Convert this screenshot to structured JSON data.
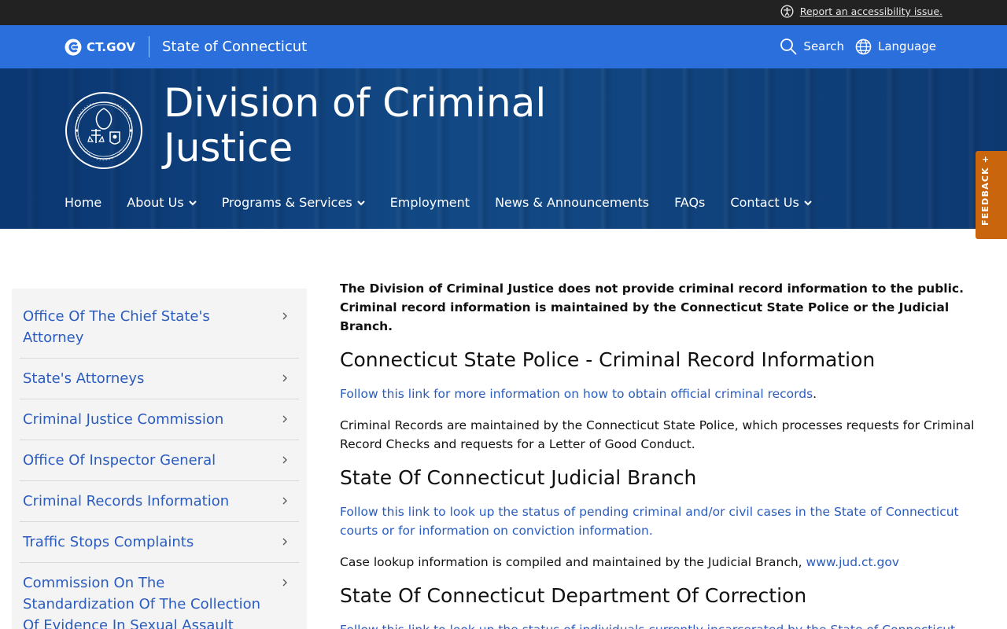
{
  "accessibility_bar": {
    "report_link": "Report an accessibility issue.",
    "icon": "accessibility-icon"
  },
  "ct_bar": {
    "logo_text": "CT.GOV",
    "state_name": "State of Connecticut",
    "search_label": "Search",
    "language_label": "Language",
    "background_color": "#2a6fdb"
  },
  "hero": {
    "title": "Division of Criminal Justice",
    "seal_icon": "division-seal-icon"
  },
  "main_nav": {
    "items": [
      {
        "label": "Home",
        "has_dropdown": false
      },
      {
        "label": "About Us",
        "has_dropdown": true
      },
      {
        "label": "Programs & Services",
        "has_dropdown": true
      },
      {
        "label": "Employment",
        "has_dropdown": false
      },
      {
        "label": "News & Announcements",
        "has_dropdown": false
      },
      {
        "label": "FAQs",
        "has_dropdown": false
      },
      {
        "label": "Contact Us",
        "has_dropdown": true
      }
    ]
  },
  "feedback": {
    "label": "FEEDBACK +",
    "color": "#c9650d"
  },
  "sidebar": {
    "items": [
      {
        "label": "Office Of The Chief State's Attorney"
      },
      {
        "label": "State's Attorneys"
      },
      {
        "label": "Criminal Justice Commission"
      },
      {
        "label": "Office Of Inspector General"
      },
      {
        "label": "Criminal Records Information"
      },
      {
        "label": "Traffic Stops Complaints"
      },
      {
        "label": "Commission On The Standardization Of The Collection Of Evidence In Sexual Assault"
      }
    ],
    "link_color": "#2a5cbf"
  },
  "content": {
    "notice": "The Division of Criminal Justice does not provide criminal record information to the public. Criminal record information is maintained by the Connecticut State Police or the Judicial Branch.",
    "sections": [
      {
        "heading": "Connecticut State Police - Criminal Record Information",
        "link_text": "Follow this link for more information on how to obtain official criminal records",
        "link_suffix": ".",
        "body": "Criminal Records are maintained by the Connecticut State Police, which processes requests for Criminal Record Checks and requests for a Letter of Good Conduct."
      },
      {
        "heading": "State Of Connecticut Judicial Branch",
        "link_text": "Follow this link to look up the status of pending criminal and/or civil cases in the State of Connecticut courts or for information on conviction information.",
        "body_prefix": "Case lookup information is compiled and maintained by the Judicial Branch, ",
        "body_link": "www.jud.ct.gov"
      },
      {
        "heading": "State Of Connecticut Department Of Correction",
        "link_text": "Follow this link to look up the status of individuals currently incarcerated by the State of Connecticut"
      }
    ]
  }
}
